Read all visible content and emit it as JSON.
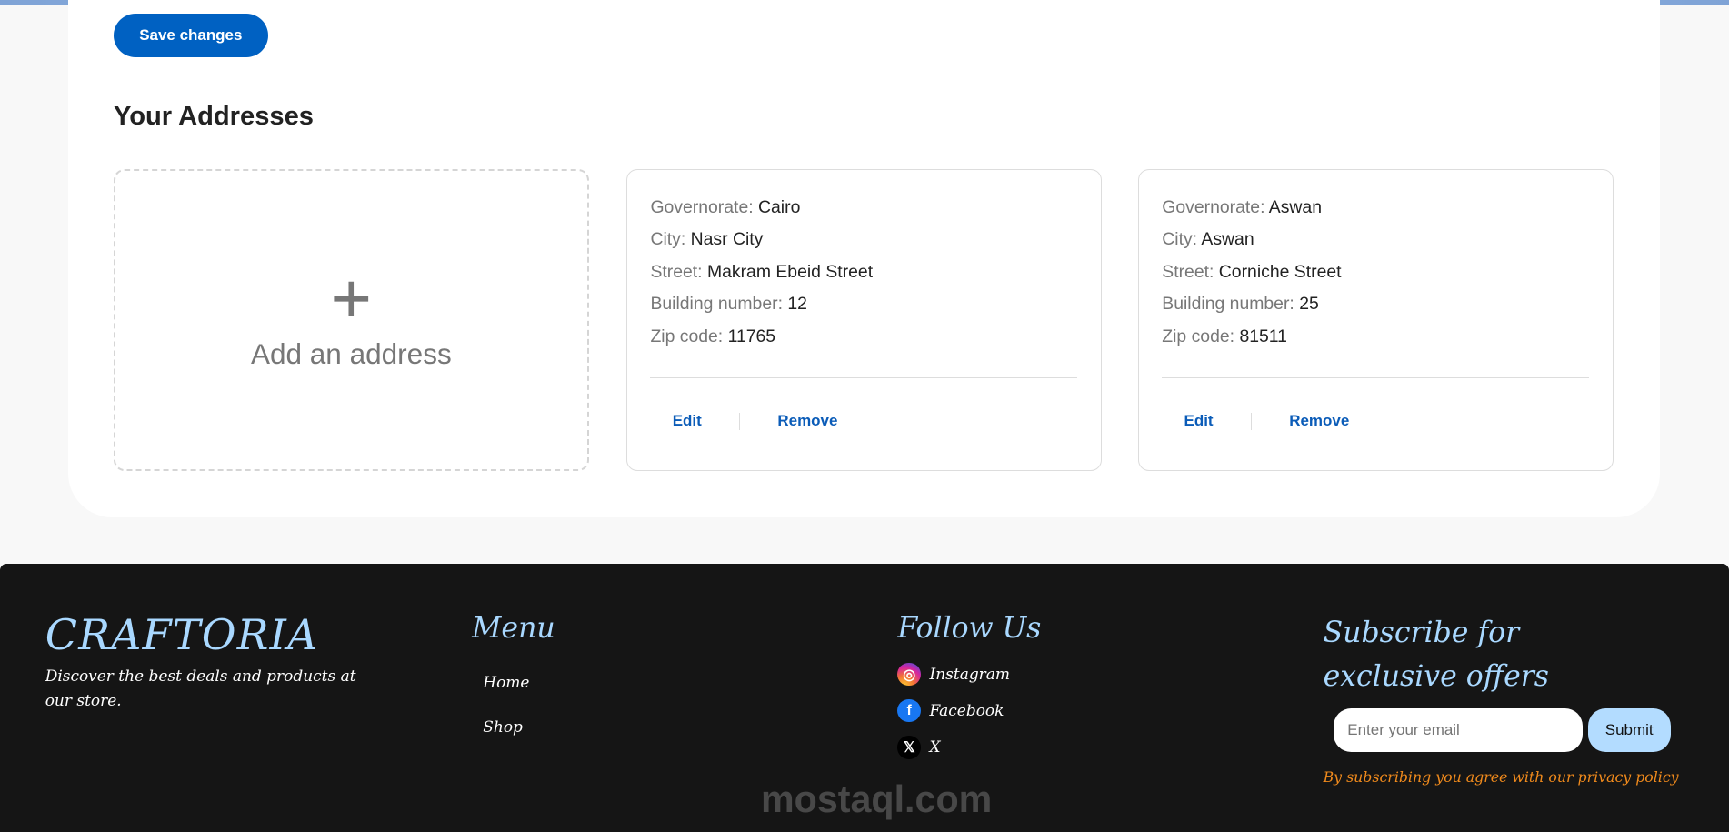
{
  "profile": {
    "save_label": "Save changes"
  },
  "addresses": {
    "title": "Your Addresses",
    "add_label": "Add an address",
    "add_icon": "+",
    "labels": {
      "governorate": "Governorate:",
      "city": "City:",
      "street": "Street:",
      "building": "Building number:",
      "zip": "Zip code:"
    },
    "items": [
      {
        "governorate": "Cairo",
        "city": "Nasr City",
        "street": "Makram Ebeid Street",
        "building": "12",
        "zip": "11765",
        "edit": "Edit",
        "remove": "Remove"
      },
      {
        "governorate": "Aswan",
        "city": "Aswan",
        "street": "Corniche Street",
        "building": "25",
        "zip": "81511",
        "edit": "Edit",
        "remove": "Remove"
      }
    ]
  },
  "footer": {
    "brand": "CRAFTORIA",
    "tagline": "Discover the best deals and products at our store.",
    "menu_title": "Menu",
    "menu": [
      "Home",
      "Shop"
    ],
    "follow_title": "Follow Us",
    "social": [
      {
        "label": "Instagram",
        "icon": "instagram-icon"
      },
      {
        "label": "Facebook",
        "icon": "facebook-icon"
      },
      {
        "label": "X",
        "icon": "x-icon"
      }
    ],
    "subscribe_title": "Subscribe for exclusive offers",
    "email_placeholder": "Enter your email",
    "submit_label": "Submit",
    "privacy": "By subscribing you agree with our privacy policy"
  },
  "watermark": "mostaql.com",
  "colors": {
    "accent": "#0061c2",
    "footer_bg": "#151515",
    "footer_heading": "#a9d8ff",
    "privacy": "#f08a1c"
  }
}
